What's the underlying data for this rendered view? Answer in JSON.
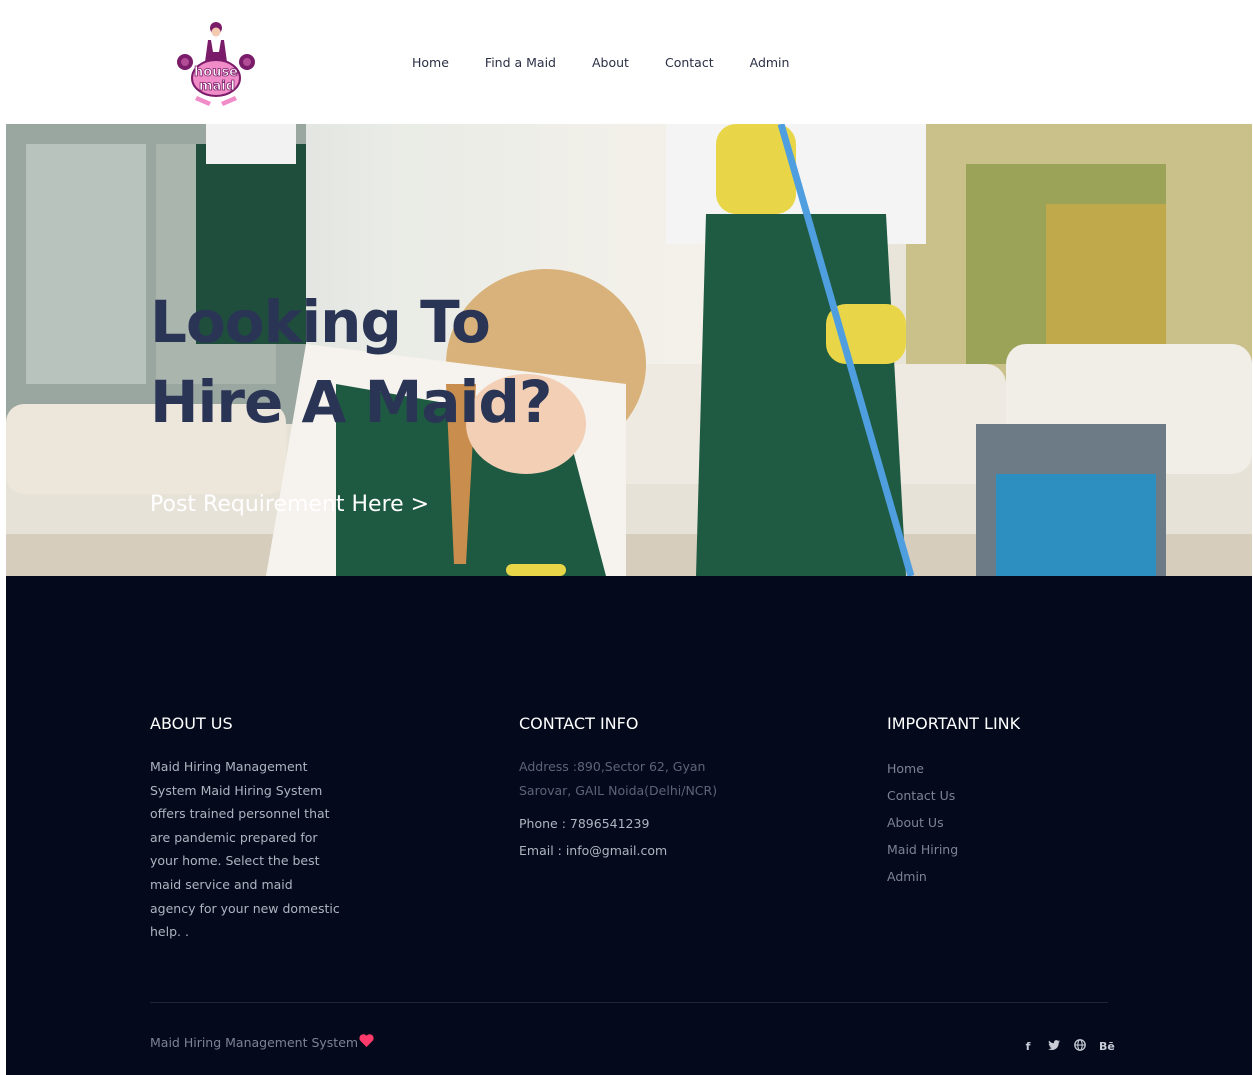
{
  "header": {
    "logo_text": "house maid",
    "nav": [
      "Home",
      "Find a Maid",
      "About",
      "Contact",
      "Admin"
    ]
  },
  "hero": {
    "title_line1": "Looking To",
    "title_line2": "Hire A Maid?",
    "cta": "Post Requirement Here >"
  },
  "footer": {
    "about": {
      "heading": "ABOUT US",
      "text": "Maid Hiring Management System Maid Hiring System offers trained personnel that are pandemic prepared for your home. Select the best maid service and maid agency for your new domestic help. ."
    },
    "contact": {
      "heading": "CONTACT INFO",
      "address": "Address :890,Sector 62, Gyan Sarovar, GAIL Noida(Delhi/NCR)",
      "phone": "Phone : 7896541239",
      "email": "Email : info@gmail.com"
    },
    "links": {
      "heading": "IMPORTANT LINK",
      "items": [
        "Home",
        "Contact Us",
        "About Us",
        "Maid Hiring",
        "Admin"
      ]
    },
    "copyright": "Maid Hiring Management System",
    "social": {
      "facebook": "f",
      "twitter": "twitter-icon",
      "web": "globe-icon",
      "behance": "Bē"
    },
    "colors": {
      "accent_heart": "#ff3b6b",
      "background": "#040a1c",
      "title": "#2a3555"
    }
  }
}
